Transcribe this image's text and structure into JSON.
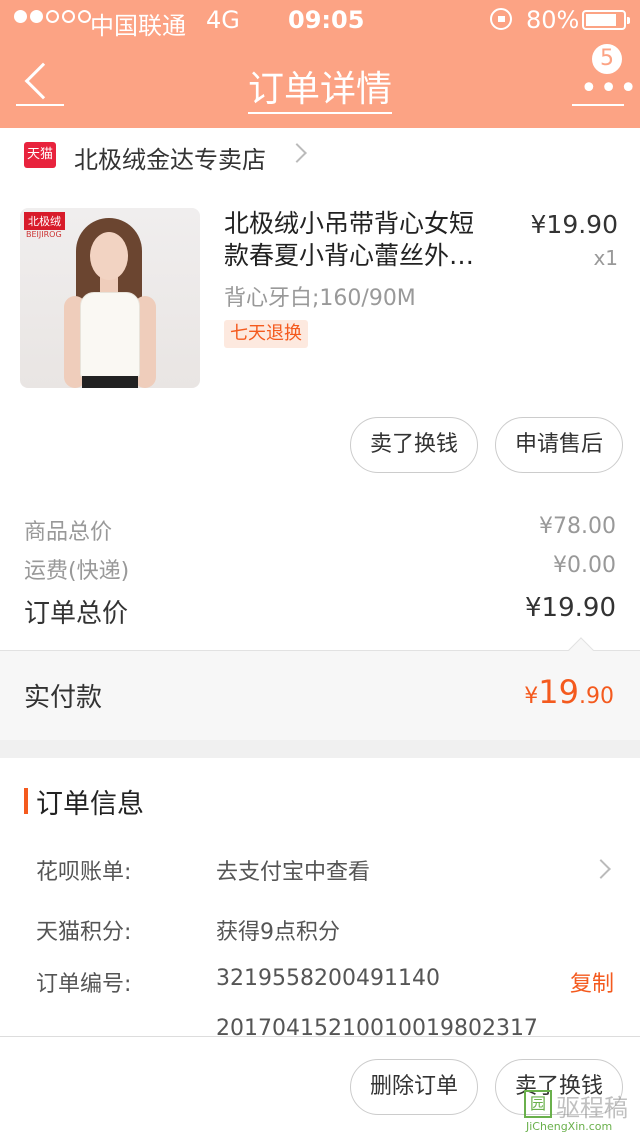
{
  "status_bar": {
    "carrier": "中国联通",
    "network": "4G",
    "time": "09:05",
    "battery": "80%"
  },
  "nav": {
    "title": "订单详情",
    "badge": "5"
  },
  "shop": {
    "logo": "天猫",
    "name": "北极绒金达专卖店"
  },
  "product": {
    "thumb_brand": "北极绒",
    "thumb_brand_sub": "BEIJIROG",
    "title_line1": "北极绒小吊带背心女短",
    "title_line2": "款春夏小背心蕾丝外…",
    "spec": "背心牙白;160/90M",
    "tag": "七天退换",
    "price": "¥19.90",
    "quantity": "x1"
  },
  "item_actions": {
    "sell": "卖了换钱",
    "after_sale": "申请售后"
  },
  "summary": {
    "goods_total_label": "商品总价",
    "goods_total": "¥78.00",
    "shipping_label": "运费(快递)",
    "shipping": "¥0.00",
    "order_total_label": "订单总价",
    "order_total": "¥19.90",
    "paid_label": "实付款",
    "paid_currency": "¥",
    "paid_int": "19",
    "paid_dec": ".90"
  },
  "order_info": {
    "heading": "订单信息",
    "huabei_label": "花呗账单:",
    "huabei_value": "去支付宝中查看",
    "points_label": "天猫积分:",
    "points_value": "获得9点积分",
    "order_no_label": "订单编号:",
    "order_no": "3219558200491140",
    "copy": "复制",
    "second_no": "20170415210010019802317"
  },
  "bottom_actions": {
    "delete": "删除订单",
    "sell": "卖了换钱"
  },
  "watermark": {
    "icon": "园",
    "name": "驱程稿",
    "url": "JiChengXin.com"
  },
  "colors": {
    "header": "#fca384",
    "accent": "#f45a1e",
    "tmall": "#e8233d"
  }
}
